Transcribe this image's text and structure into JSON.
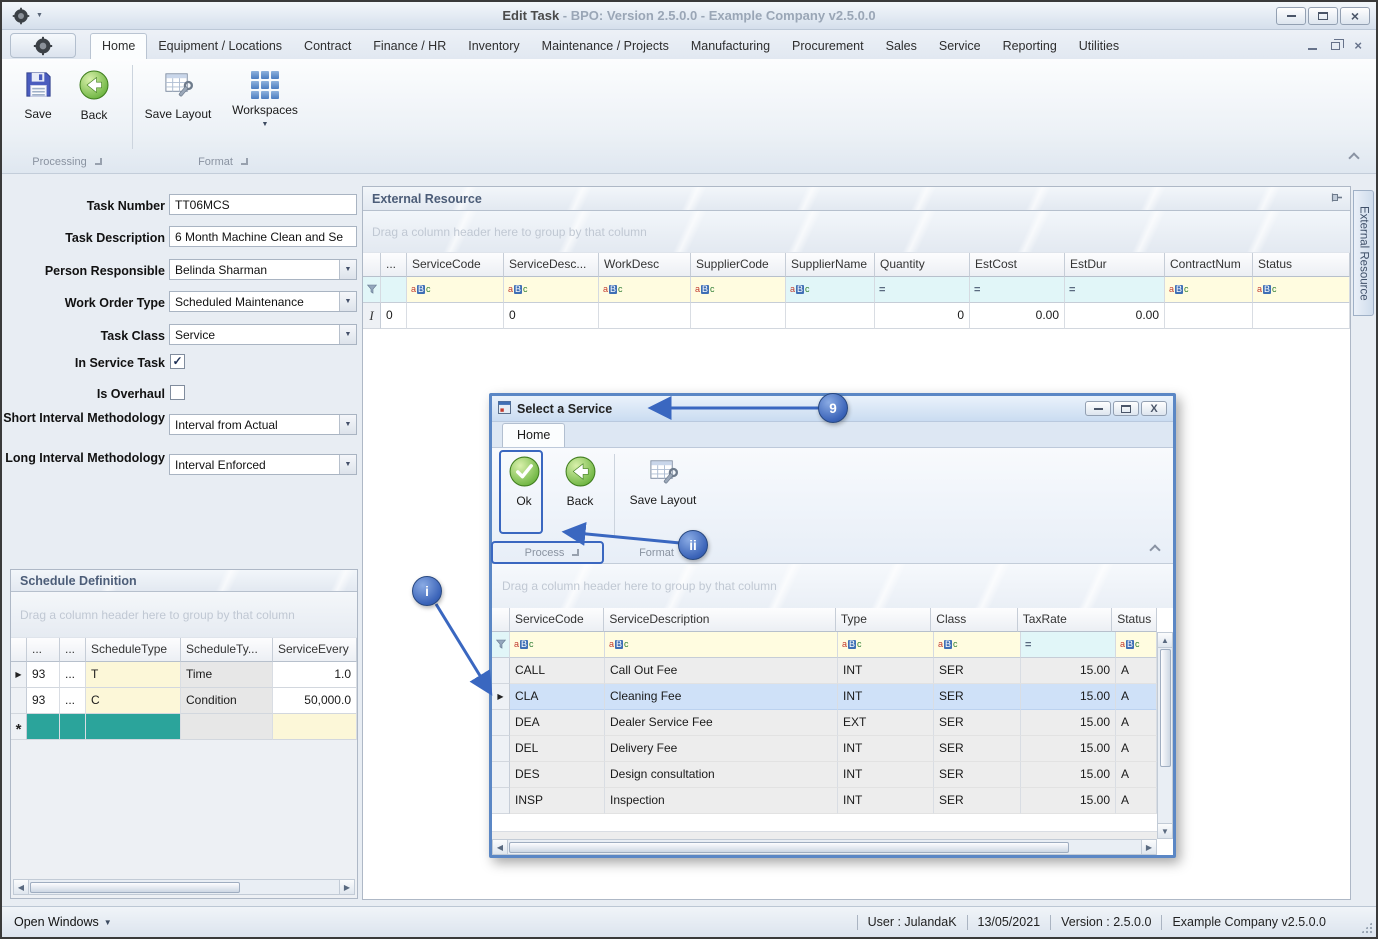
{
  "window": {
    "title": "Edit Task",
    "title_suffix": " - BPO: Version 2.5.0.0 - Example Company v2.5.0.0"
  },
  "ribbon": {
    "tabs": [
      "Home",
      "Equipment / Locations",
      "Contract",
      "Finance / HR",
      "Inventory",
      "Maintenance / Projects",
      "Manufacturing",
      "Procurement",
      "Sales",
      "Service",
      "Reporting",
      "Utilities"
    ],
    "active_tab": "Home",
    "save_label": "Save",
    "back_label": "Back",
    "save_layout_label": "Save Layout",
    "workspaces_label": "Workspaces",
    "group_processing": "Processing",
    "group_format": "Format"
  },
  "form": {
    "task_number": {
      "label": "Task Number",
      "value": "TT06MCS"
    },
    "task_description": {
      "label": "Task Description",
      "value": "6 Month Machine Clean and Se"
    },
    "person_responsible": {
      "label": "Person Responsible",
      "value": "Belinda Sharman"
    },
    "work_order_type": {
      "label": "Work Order Type",
      "value": "Scheduled Maintenance"
    },
    "task_class": {
      "label": "Task Class",
      "value": "Service"
    },
    "in_service_task": {
      "label": "In Service Task",
      "checked": true
    },
    "is_overhaul": {
      "label": "Is Overhaul",
      "checked": false
    },
    "short_interval": {
      "label": "Short Interval Methodology",
      "value": "Interval from Actual"
    },
    "long_interval": {
      "label": "Long Interval Methodology",
      "value": "Interval Enforced"
    }
  },
  "external_resource": {
    "caption": "External Resource",
    "group_hint": "Drag a column header here to group by that column",
    "columns": [
      "...",
      "ServiceCode",
      "ServiceDesc...",
      "WorkDesc",
      "SupplierCode",
      "SupplierName",
      "Quantity",
      "EstCost",
      "EstDur",
      "ContractNum",
      "Status"
    ],
    "filter_row": [
      {
        "icon": "funnel",
        "bg": "cyan"
      },
      {
        "icon": "",
        "bg": "cyan"
      },
      {
        "icon": "abc",
        "bg": "yellow"
      },
      {
        "icon": "abc",
        "bg": "yellow"
      },
      {
        "icon": "abc",
        "bg": "yellow"
      },
      {
        "icon": "abc",
        "bg": "yellow"
      },
      {
        "icon": "abc",
        "bg": "cyan"
      },
      {
        "icon": "eq",
        "bg": "cyan"
      },
      {
        "icon": "eq",
        "bg": "cyan"
      },
      {
        "icon": "eq",
        "bg": "cyan"
      },
      {
        "icon": "abc",
        "bg": "yellow"
      },
      {
        "icon": "abc",
        "bg": "yellow"
      }
    ],
    "rows": [
      {
        "indicator": "ibeam",
        "cells": [
          "0",
          "",
          "0",
          "",
          "",
          "",
          "0",
          "0.00",
          "0.00",
          "",
          ""
        ]
      }
    ]
  },
  "schedule": {
    "caption": "Schedule Definition",
    "group_hint": "Drag a column header here to group by that column",
    "columns": [
      "...",
      "...",
      "ScheduleType",
      "ScheduleTy...",
      "ServiceEvery"
    ],
    "rows": [
      {
        "indicator": "arrow",
        "cells": [
          {
            "t": "93"
          },
          {
            "t": "..."
          },
          {
            "t": "T",
            "bg": "yellow"
          },
          {
            "t": "Time",
            "bg": "shade"
          },
          {
            "t": "1.0",
            "align": "right"
          }
        ]
      },
      {
        "indicator": "",
        "cells": [
          {
            "t": "93"
          },
          {
            "t": "..."
          },
          {
            "t": "C",
            "bg": "yellow"
          },
          {
            "t": "Condition",
            "bg": "shade"
          },
          {
            "t": "50,000.0",
            "align": "right"
          }
        ]
      },
      {
        "indicator": "star",
        "cells": [
          {
            "t": "",
            "bg": "teal"
          },
          {
            "t": "",
            "bg": "teal"
          },
          {
            "t": "",
            "bg": "teal"
          },
          {
            "t": "",
            "bg": "shade"
          },
          {
            "t": "",
            "bg": "yellow"
          }
        ]
      }
    ]
  },
  "dialog": {
    "title": "Select a Service",
    "tab_home": "Home",
    "ok_label": "Ok",
    "back_label": "Back",
    "save_layout_label": "Save Layout",
    "group_process": "Process",
    "group_format": "Format",
    "group_hint": "Drag a column header here to group by that column",
    "columns": [
      "ServiceCode",
      "ServiceDescription",
      "Type",
      "Class",
      "TaxRate",
      "Status"
    ],
    "filter_row": [
      {
        "icon": "funnel",
        "bg": "cyan"
      },
      {
        "icon": "abc",
        "bg": "yellow"
      },
      {
        "icon": "abc",
        "bg": "yellow"
      },
      {
        "icon": "abc",
        "bg": "yellow"
      },
      {
        "icon": "abc",
        "bg": "yellow"
      },
      {
        "icon": "eq",
        "bg": "cyan"
      },
      {
        "icon": "abc",
        "bg": "yellow"
      }
    ],
    "rows": [
      {
        "indicator": "",
        "cells": [
          "CALL",
          "Call Out Fee",
          "INT",
          "SER",
          "15.00",
          "A"
        ]
      },
      {
        "indicator": "arrow",
        "selected": true,
        "cells": [
          "CLA",
          "Cleaning Fee",
          "INT",
          "SER",
          "15.00",
          "A"
        ]
      },
      {
        "indicator": "",
        "cells": [
          "DEA",
          "Dealer Service Fee",
          "EXT",
          "SER",
          "15.00",
          "A"
        ]
      },
      {
        "indicator": "",
        "cells": [
          "DEL",
          "Delivery Fee",
          "INT",
          "SER",
          "15.00",
          "A"
        ]
      },
      {
        "indicator": "",
        "cells": [
          "DES",
          "Design consultation",
          "INT",
          "SER",
          "15.00",
          "A"
        ]
      },
      {
        "indicator": "",
        "cells": [
          "INSP",
          "Inspection",
          "INT",
          "SER",
          "15.00",
          "A"
        ]
      }
    ]
  },
  "annotations": {
    "step_9": "9",
    "step_ii": "ii",
    "step_i": "i"
  },
  "statusbar": {
    "open_windows": "Open Windows",
    "items": [
      "User : JulandaK",
      "13/05/2021",
      "Version : 2.5.0.0",
      "Example Company v2.5.0.0"
    ]
  },
  "side_tab": "External Resource"
}
